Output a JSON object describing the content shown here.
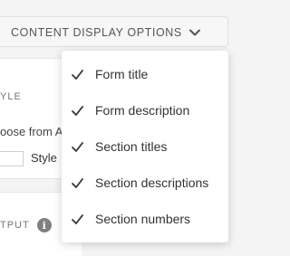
{
  "toolbar": {
    "content_display_label": "CONTENT DISPLAY OPTIONS",
    "chevron_icon": "chevron-down-icon"
  },
  "style_section": {
    "heading": "YLE",
    "choose_text": "oose from Ap",
    "style_label": "Style"
  },
  "output_section": {
    "heading": "TPUT",
    "info_icon_glyph": "i"
  },
  "dropdown": {
    "items": [
      {
        "label": "Form title",
        "checked": true
      },
      {
        "label": "Form description",
        "checked": true
      },
      {
        "label": "Section titles",
        "checked": true
      },
      {
        "label": "Section descriptions",
        "checked": true
      },
      {
        "label": "Section numbers",
        "checked": true
      }
    ]
  }
}
